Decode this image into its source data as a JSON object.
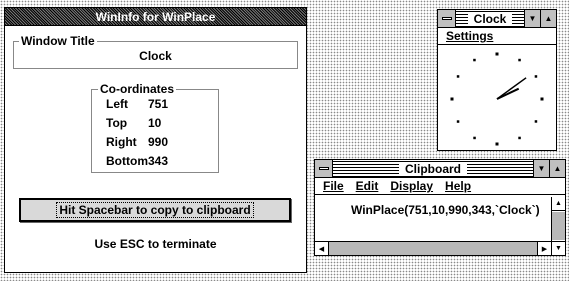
{
  "wininfo": {
    "title": "WinInfo for WinPlace",
    "window_title_label": "Window Title",
    "window_title_value": "Clock",
    "coords_label": "Co-ordinates",
    "coords": [
      {
        "label": "Left",
        "value": "751"
      },
      {
        "label": "Top",
        "value": "10"
      },
      {
        "label": "Right",
        "value": "990"
      },
      {
        "label": "Bottom",
        "value": "343"
      }
    ],
    "copy_button": "Hit Spacebar to copy to clipboard",
    "esc_note": "Use ESC to terminate"
  },
  "clock": {
    "title": "Clock",
    "menu_settings": "Settings",
    "time": {
      "hour": 2,
      "minute": 9
    }
  },
  "clipboard": {
    "title": "Clipboard",
    "menu": [
      "File",
      "Edit",
      "Display",
      "Help"
    ],
    "content": "WinPlace(751,10,990,343,`Clock`)"
  }
}
